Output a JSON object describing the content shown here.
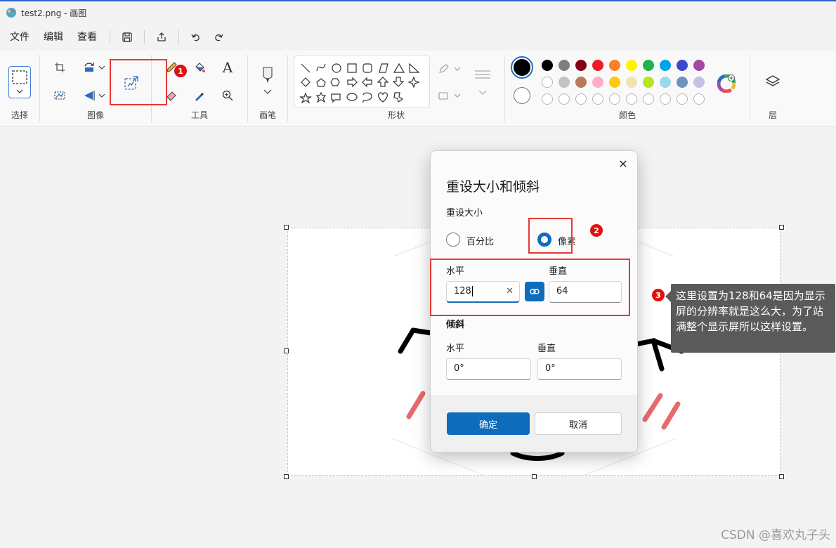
{
  "titlebar": {
    "title": "test2.png - 画图"
  },
  "menu": {
    "file": "文件",
    "edit": "编辑",
    "view": "查看"
  },
  "ribbon": {
    "groups": {
      "select": "选择",
      "image": "图像",
      "tools": "工具",
      "brush": "画笔",
      "shapes": "形状",
      "colors": "颜色",
      "layers": "层"
    },
    "text_tool_glyph": "A",
    "palette": {
      "primary": "#000000",
      "secondary": "#ffffff",
      "row1": [
        "#000000",
        "#7f7f7f",
        "#880015",
        "#ed1c24",
        "#ff7f27",
        "#fff200",
        "#22b14c",
        "#00a2e8",
        "#3f48cc",
        "#a349a4"
      ],
      "row2": [
        "#ffffff",
        "#c3c3c3",
        "#b97a57",
        "#ffaec9",
        "#ffc90e",
        "#efe4b0",
        "#b5e61d",
        "#99d9ea",
        "#7092be",
        "#c8bfe7"
      ]
    }
  },
  "annotations": {
    "badge1": "1",
    "badge2": "2",
    "badge3": "3",
    "note": "这里设置为128和64是因为显示屏的分辨率就是这么大，为了站满整个显示屏所以这样设置。",
    "highlight_color": "#e53935"
  },
  "dialog": {
    "title": "重设大小和倾斜",
    "resize_section": "重设大小",
    "option_percent": "百分比",
    "option_pixels": "像素",
    "selected_option": "像素",
    "resize_horizontal_label": "水平",
    "resize_vertical_label": "垂直",
    "resize_horizontal_value": "128",
    "resize_vertical_value": "64",
    "skew_section": "倾斜",
    "skew_horizontal_label": "水平",
    "skew_vertical_label": "垂直",
    "skew_horizontal_value": "0°",
    "skew_vertical_value": "0°",
    "ok": "确定",
    "cancel": "取消",
    "close_glyph": "✕",
    "clear_glyph": "✕"
  },
  "watermark": "CSDN @喜欢丸子头"
}
